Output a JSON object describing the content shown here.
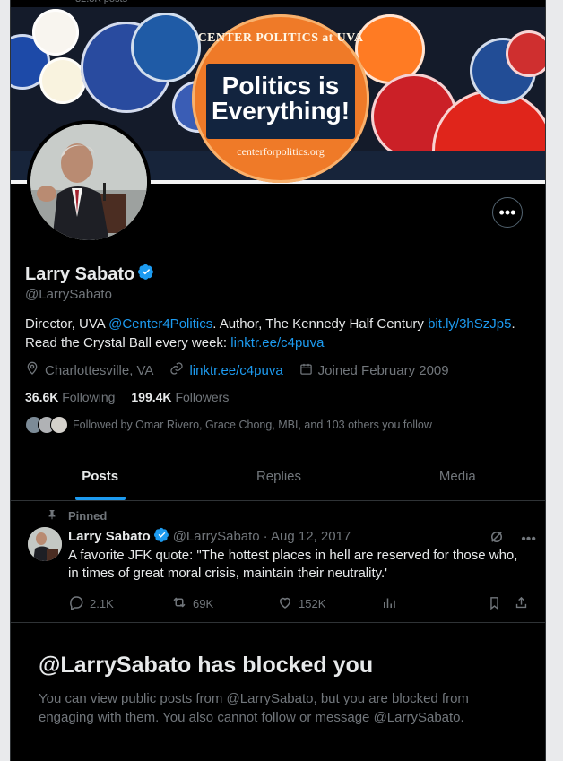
{
  "profile": {
    "name": "Larry Sabato",
    "handle": "@LarrySabato",
    "bio_parts": {
      "p1": "Director, UVA ",
      "link1": "@Center4Politics",
      "p2": ". Author, The Kennedy Half Century ",
      "link2": "bit.ly/3hSzJp5",
      "p3": ".",
      "line2": "Read the Crystal Ball every week: ",
      "link3": "linktr.ee/c4puva"
    },
    "location": "Charlottesville, VA",
    "website": "linktr.ee/c4puva",
    "joined": "Joined February 2009",
    "following_count": "36.6K",
    "following_label": "Following",
    "followers_count": "199.4K",
    "followers_label": "Followers",
    "followed_by": "Followed by Omar Rivero, Grace Chong, MBI, and 103 others you follow"
  },
  "banner": {
    "top": "CENTER POLITICS at UVA",
    "main_line1": "Politics is",
    "main_line2": "Everything!",
    "url": "centerforpolitics.org"
  },
  "tabs": [
    "Posts",
    "Replies",
    "Media"
  ],
  "post": {
    "pinned": "Pinned",
    "name": "Larry Sabato",
    "handle": "@LarrySabato",
    "date": "· Aug 12, 2017",
    "text": "A favorite JFK quote: \"The hottest places in hell are reserved for those who, in times of great moral crisis, maintain their neutrality.'",
    "replies": "2.1K",
    "reposts": "69K",
    "likes": "152K"
  },
  "blocked": {
    "title": "@LarrySabato has blocked you",
    "text": "You can view public posts from @LarrySabato, but you are blocked from engaging with them. You also cannot follow or message @LarrySabato."
  },
  "colors": {
    "accent": "#1d9bf0",
    "text_primary": "#e7e9ea",
    "text_secondary": "#71767b",
    "background": "#000000"
  }
}
